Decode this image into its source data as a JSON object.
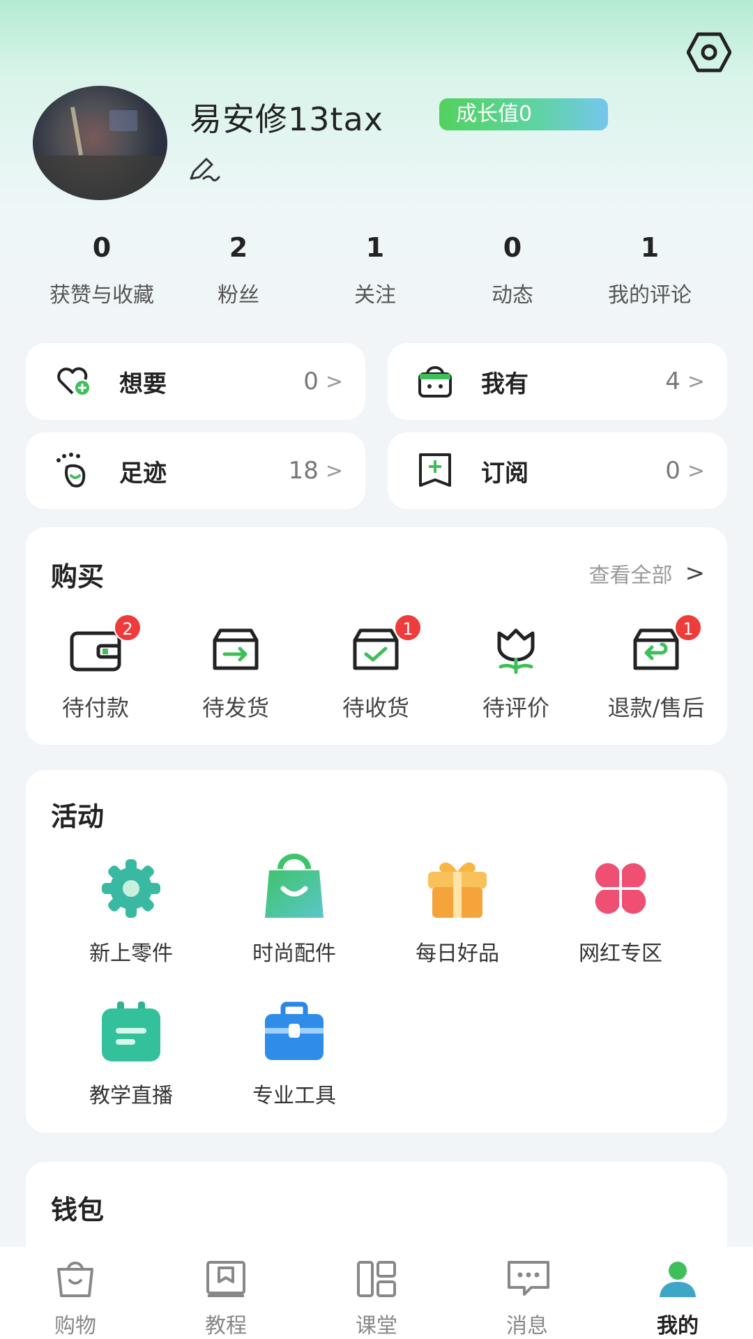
{
  "profile": {
    "username": "易安修13tax",
    "growth_label": "成长值0"
  },
  "stats": [
    {
      "value": "0",
      "label": "获赞与收藏"
    },
    {
      "value": "2",
      "label": "粉丝"
    },
    {
      "value": "1",
      "label": "关注"
    },
    {
      "value": "0",
      "label": "动态"
    },
    {
      "value": "1",
      "label": "我的评论"
    }
  ],
  "quick": [
    {
      "label": "想要",
      "value": "0",
      "icon": "heart-plus-icon"
    },
    {
      "label": "我有",
      "value": "4",
      "icon": "bag-icon"
    },
    {
      "label": "足迹",
      "value": "18",
      "icon": "footprint-icon"
    },
    {
      "label": "订阅",
      "value": "0",
      "icon": "bookmark-plus-icon"
    }
  ],
  "purchase": {
    "title": "购买",
    "view_all": "查看全部",
    "items": [
      {
        "label": "待付款",
        "badge": "2",
        "icon": "wallet-icon"
      },
      {
        "label": "待发货",
        "badge": "",
        "icon": "box-arrow-icon"
      },
      {
        "label": "待收货",
        "badge": "1",
        "icon": "box-check-icon"
      },
      {
        "label": "待评价",
        "badge": "",
        "icon": "flower-icon"
      },
      {
        "label": "退款/售后",
        "badge": "1",
        "icon": "box-return-icon"
      }
    ]
  },
  "activity": {
    "title": "活动",
    "items": [
      {
        "label": "新上零件",
        "icon": "gear-icon"
      },
      {
        "label": "时尚配件",
        "icon": "shopping-bag-icon"
      },
      {
        "label": "每日好品",
        "icon": "gift-icon"
      },
      {
        "label": "网红专区",
        "icon": "clover-icon"
      },
      {
        "label": "教学直播",
        "icon": "calendar-icon"
      },
      {
        "label": "专业工具",
        "icon": "toolbox-icon"
      }
    ]
  },
  "wallet": {
    "title": "钱包"
  },
  "nav": [
    {
      "label": "购物",
      "icon": "shopping-icon"
    },
    {
      "label": "教程",
      "icon": "tutorial-icon"
    },
    {
      "label": "课堂",
      "icon": "classroom-icon"
    },
    {
      "label": "消息",
      "icon": "message-icon"
    },
    {
      "label": "我的",
      "icon": "profile-icon",
      "active": true
    }
  ],
  "colors": {
    "accent_green": "#3fbf5a",
    "badge_red": "#ee3b3b"
  }
}
